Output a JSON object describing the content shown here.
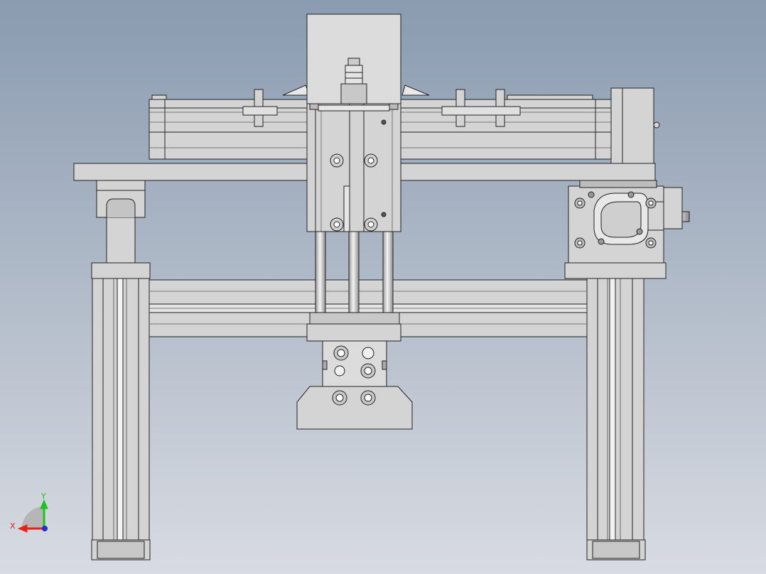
{
  "viewport": {
    "background_top": "#8a9bb0",
    "background_bottom": "#d8dbe2"
  },
  "colors": {
    "part_fill": "#d4d4d4",
    "part_fill_light": "#e2e2e2",
    "part_fill_dark": "#b8b8b8",
    "edge": "#222222",
    "rod": "#c8c8c8",
    "axis_x": "#e8201a",
    "axis_y": "#1ec21e",
    "axis_z": "#2030c8"
  },
  "triad": {
    "x_label": "X",
    "y_label": "Y"
  }
}
